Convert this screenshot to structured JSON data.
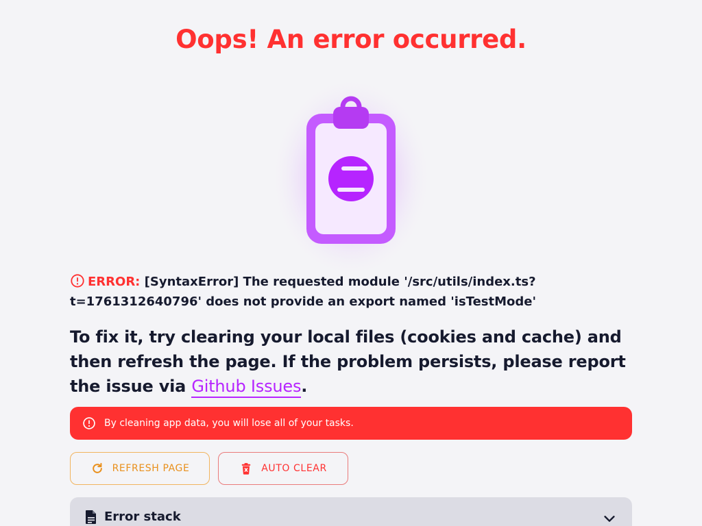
{
  "title": "Oops! An error occurred.",
  "error": {
    "label": "ERROR:",
    "message": "[SyntaxError] The requested module '/src/utils/index.ts?t=1761312640796' does not provide an export named 'isTestMode'"
  },
  "fix": {
    "text_before": "To fix it, try clearing your local files (cookies and cache) and then refresh the page. If the problem persists, please report the issue via ",
    "link_text": "Github Issues",
    "text_after": "."
  },
  "alert": {
    "text": "By cleaning app data, you will lose all of your tasks."
  },
  "buttons": {
    "refresh": "REFRESH PAGE",
    "auto_clear": "AUTO CLEAR"
  },
  "stack": {
    "title": "Error stack"
  },
  "colors": {
    "error": "#ff3131",
    "accent": "#b624ff",
    "warning": "#e9901c"
  },
  "icons": {
    "error_line": "error-circle-icon",
    "alert": "error-circle-icon",
    "refresh": "refresh-icon",
    "auto_clear": "trash-icon",
    "stack": "document-icon",
    "stack_toggle": "chevron-down-icon",
    "illustration": "clipboard-lock-icon"
  }
}
